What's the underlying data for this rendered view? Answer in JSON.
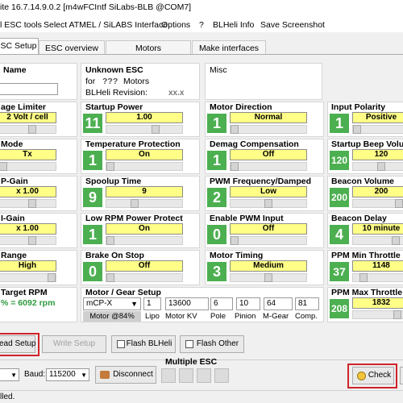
{
  "title": "ite 16.7.14.9.0.2  [m4wFCIntf SiLabs-BLB @COM7]",
  "menu": [
    {
      "label": "l ESC tools"
    },
    {
      "label": "Select ATMEL / SiLABS Interface"
    },
    {
      "label": "Options"
    },
    {
      "label": "?"
    },
    {
      "label": "BLHeli Info"
    },
    {
      "label": "Save Screenshot"
    }
  ],
  "tabs": [
    "SC Setup",
    "ESC overview",
    "Motors",
    "Make interfaces"
  ],
  "header": {
    "name_label": "Name",
    "unknown_esc": "Unknown ESC",
    "for_label": "for",
    "motors_q": "???",
    "motors_label": "Motors",
    "revision_label": "BLHeli Revision:",
    "revision_val": "xx.x",
    "misc_label": "Misc"
  },
  "params": {
    "voltage_limiter": {
      "label": "age Limiter",
      "value": "2 Volt / cell"
    },
    "startup_power": {
      "label": "Startup Power",
      "value": "1.00",
      "num": "11"
    },
    "motor_direction": {
      "label": "Motor Direction",
      "value": "Normal",
      "num": "1"
    },
    "input_polarity": {
      "label": "Input Polarity",
      "value": "Positive",
      "num": "1"
    },
    "mode": {
      "label": "Mode",
      "value": "Tx"
    },
    "temp_protection": {
      "label": "Temperature Protection",
      "value": "On",
      "num": "1"
    },
    "demag": {
      "label": "Demag Compensation",
      "value": "Off",
      "num": "1"
    },
    "startup_beep": {
      "label": "Startup Beep Volume",
      "value": "120",
      "num": "120"
    },
    "p_gain": {
      "label": "P-Gain",
      "value": "x 1.00"
    },
    "spoolup": {
      "label": "Spoolup Time",
      "value": "9",
      "num": "9"
    },
    "pwm_freq": {
      "label": "PWM Frequency/Damped",
      "value": "Low",
      "num": "2"
    },
    "beacon_volume": {
      "label": "Beacon Volume",
      "value": "200",
      "num": "200"
    },
    "i_gain": {
      "label": "I-Gain",
      "value": "x 1.00"
    },
    "low_rpm": {
      "label": "Low RPM Power Protect",
      "value": "On",
      "num": "1"
    },
    "enable_pwm": {
      "label": "Enable PWM Input",
      "value": "Off",
      "num": "0"
    },
    "beacon_delay": {
      "label": "Beacon Delay",
      "value": "10 minute",
      "num": "4"
    },
    "range": {
      "label": "Range",
      "value": "High"
    },
    "brake": {
      "label": "Brake On Stop",
      "value": "Off",
      "num": "0"
    },
    "motor_timing": {
      "label": "Motor Timing",
      "value": "Medium",
      "num": "3"
    },
    "ppm_min": {
      "label": "PPM Min Throttle",
      "value": "1148",
      "num": "37"
    },
    "target_rpm": {
      "label": "Target RPM",
      "value": "% = 6092 rpm"
    },
    "ppm_max": {
      "label": "PPM Max Throttle",
      "value": "1832",
      "num": "208"
    }
  },
  "gear": {
    "label": "Motor / Gear Setup",
    "motor": "mCP-X",
    "lipo": "1",
    "kv": "13600",
    "pole": "6",
    "pinion": "10",
    "mgear": "64",
    "comp": "81",
    "lipo_lbl": "Lipo",
    "kv_lbl": "Motor KV",
    "pole_lbl": "Pole",
    "pinion_lbl": "Pinion",
    "mgear_lbl": "M-Gear",
    "comp_lbl": "Comp.",
    "motor_pct": "Motor @84%"
  },
  "actions": {
    "read": "ead Setup",
    "write": "Write Setup",
    "flash_blheli": "Flash BLHeli",
    "flash_other": "Flash Other"
  },
  "bottom": {
    "multiple_esc": "Multiple ESC",
    "baud_label": "Baud:",
    "baud_value": "115200",
    "disconnect": "Disconnect",
    "check": "Check",
    "status": "lled."
  }
}
